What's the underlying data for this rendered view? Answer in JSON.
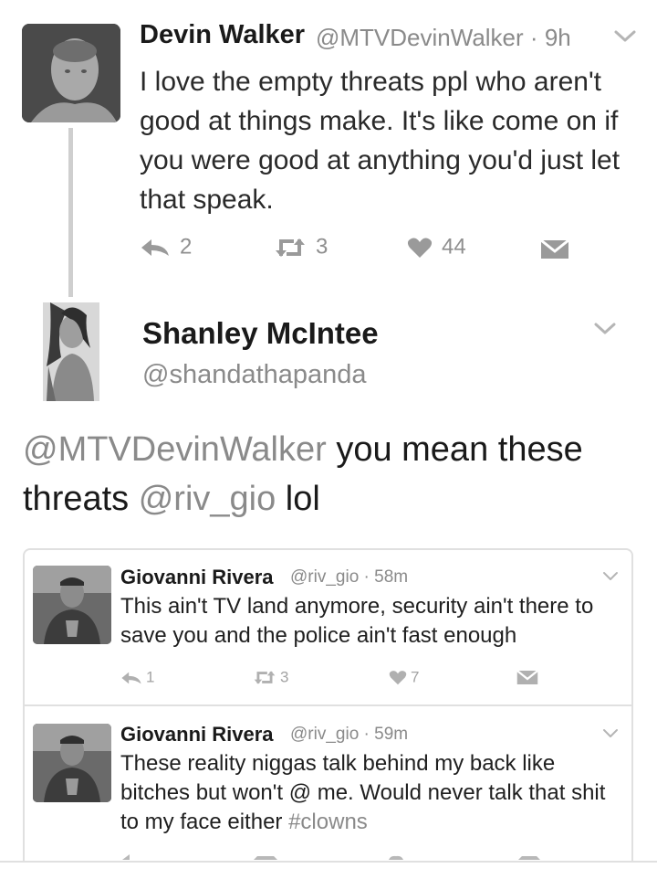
{
  "tweet": {
    "author_name": "Devin Walker",
    "author_handle": "@MTVDevinWalker",
    "time_separator": "·",
    "time": "9h",
    "text": "I love the empty threats ppl who aren't good at things make. It's like come on if you were good at anything you'd just let that speak.",
    "replies": "2",
    "retweets": "3",
    "likes": "44"
  },
  "reply": {
    "author_name": "Shanley McIntee",
    "author_handle": "@shandathapanda",
    "mention_1": "@MTVDevinWalker",
    "text_1": " you mean these threats ",
    "mention_2": "@riv_gio",
    "text_2": " lol"
  },
  "quoted": [
    {
      "author_name": "Giovanni Rivera",
      "author_handle": "@riv_gio",
      "time": "58m",
      "text": "This ain't TV land anymore, security ain't there to save you and the police ain't fast enough",
      "replies": "1",
      "retweets": "3",
      "likes": "7"
    },
    {
      "author_name": "Giovanni Rivera",
      "author_handle": "@riv_gio",
      "time": "59m",
      "text": "These reality niggas talk behind my back like bitches but won't @ me. Would never talk that shit to my face either ",
      "hashtag": "#clowns"
    }
  ],
  "colors": {
    "text": "#1a1a1a",
    "muted": "#8a8a8a",
    "border": "#e0e0e0",
    "background": "#ffffff"
  }
}
